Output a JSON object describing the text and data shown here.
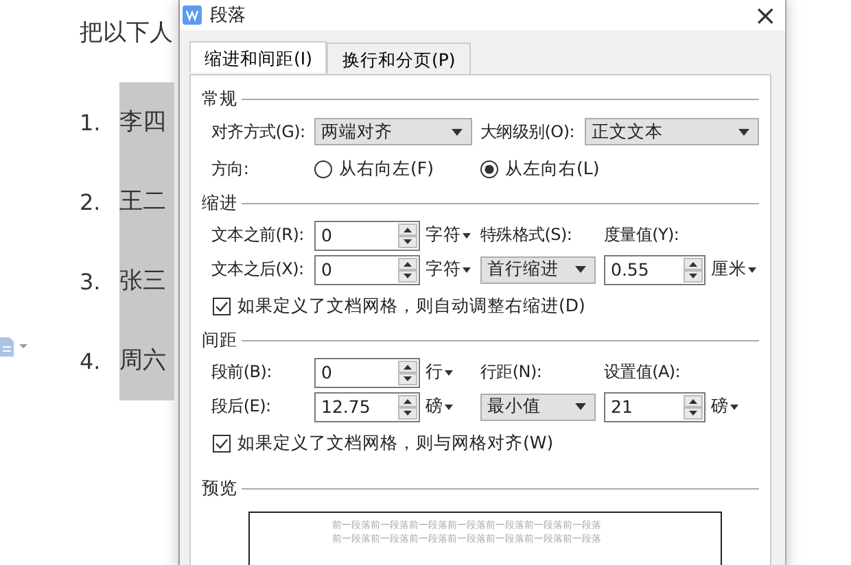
{
  "document": {
    "heading": "把以下人",
    "list": [
      {
        "number": "1.",
        "name": "李四",
        "highlighted": true
      },
      {
        "number": "2.",
        "name": "王二",
        "highlighted": true
      },
      {
        "number": "3.",
        "name": "张三",
        "highlighted": true
      },
      {
        "number": "4.",
        "name": "周六",
        "highlighted": true
      }
    ]
  },
  "dialog": {
    "title": "段落",
    "close": "×",
    "tabs": [
      {
        "label": "缩进和间距(I)",
        "selected": true
      },
      {
        "label": "换行和分页(P)",
        "selected": false
      }
    ],
    "general": {
      "title": "常规",
      "alignment": {
        "label": "对齐方式(G):",
        "value": "两端对齐"
      },
      "outline": {
        "label": "大纲级别(O):",
        "value": "正文文本"
      },
      "direction": {
        "label": "方向:",
        "options": [
          {
            "label": "从右向左(F)",
            "selected": false
          },
          {
            "label": "从左向右(L)",
            "selected": true
          }
        ]
      }
    },
    "indent": {
      "title": "缩进",
      "before": {
        "label": "文本之前(R):",
        "value": "0",
        "unit": "字符"
      },
      "after": {
        "label": "文本之后(X):",
        "value": "0",
        "unit": "字符"
      },
      "special": {
        "label": "特殊格式(S):",
        "value": "首行缩进"
      },
      "measure": {
        "label": "度量值(Y):",
        "value": "0.55",
        "unit": "厘米"
      },
      "grid_option": {
        "label": "如果定义了文档网格，则自动调整右缩进(D)",
        "checked": true
      }
    },
    "spacing": {
      "title": "间距",
      "before": {
        "label": "段前(B):",
        "value": "0",
        "unit": "行"
      },
      "after": {
        "label": "段后(E):",
        "value": "12.75",
        "unit": "磅"
      },
      "line_spacing": {
        "label": "行距(N):",
        "value": "最小值"
      },
      "setting": {
        "label": "设置值(A):",
        "value": "21",
        "unit": "磅"
      },
      "grid_option": {
        "label": "如果定义了文档网格，则与网格对齐(W)",
        "checked": true
      }
    },
    "preview": {
      "title": "预览",
      "lines": [
        "前一段落前一段落前一段落前一段落前一段落前一段落前一段落",
        "前一段落前一段落前一段落前一段落前一段落前一段落前一段落"
      ]
    }
  }
}
